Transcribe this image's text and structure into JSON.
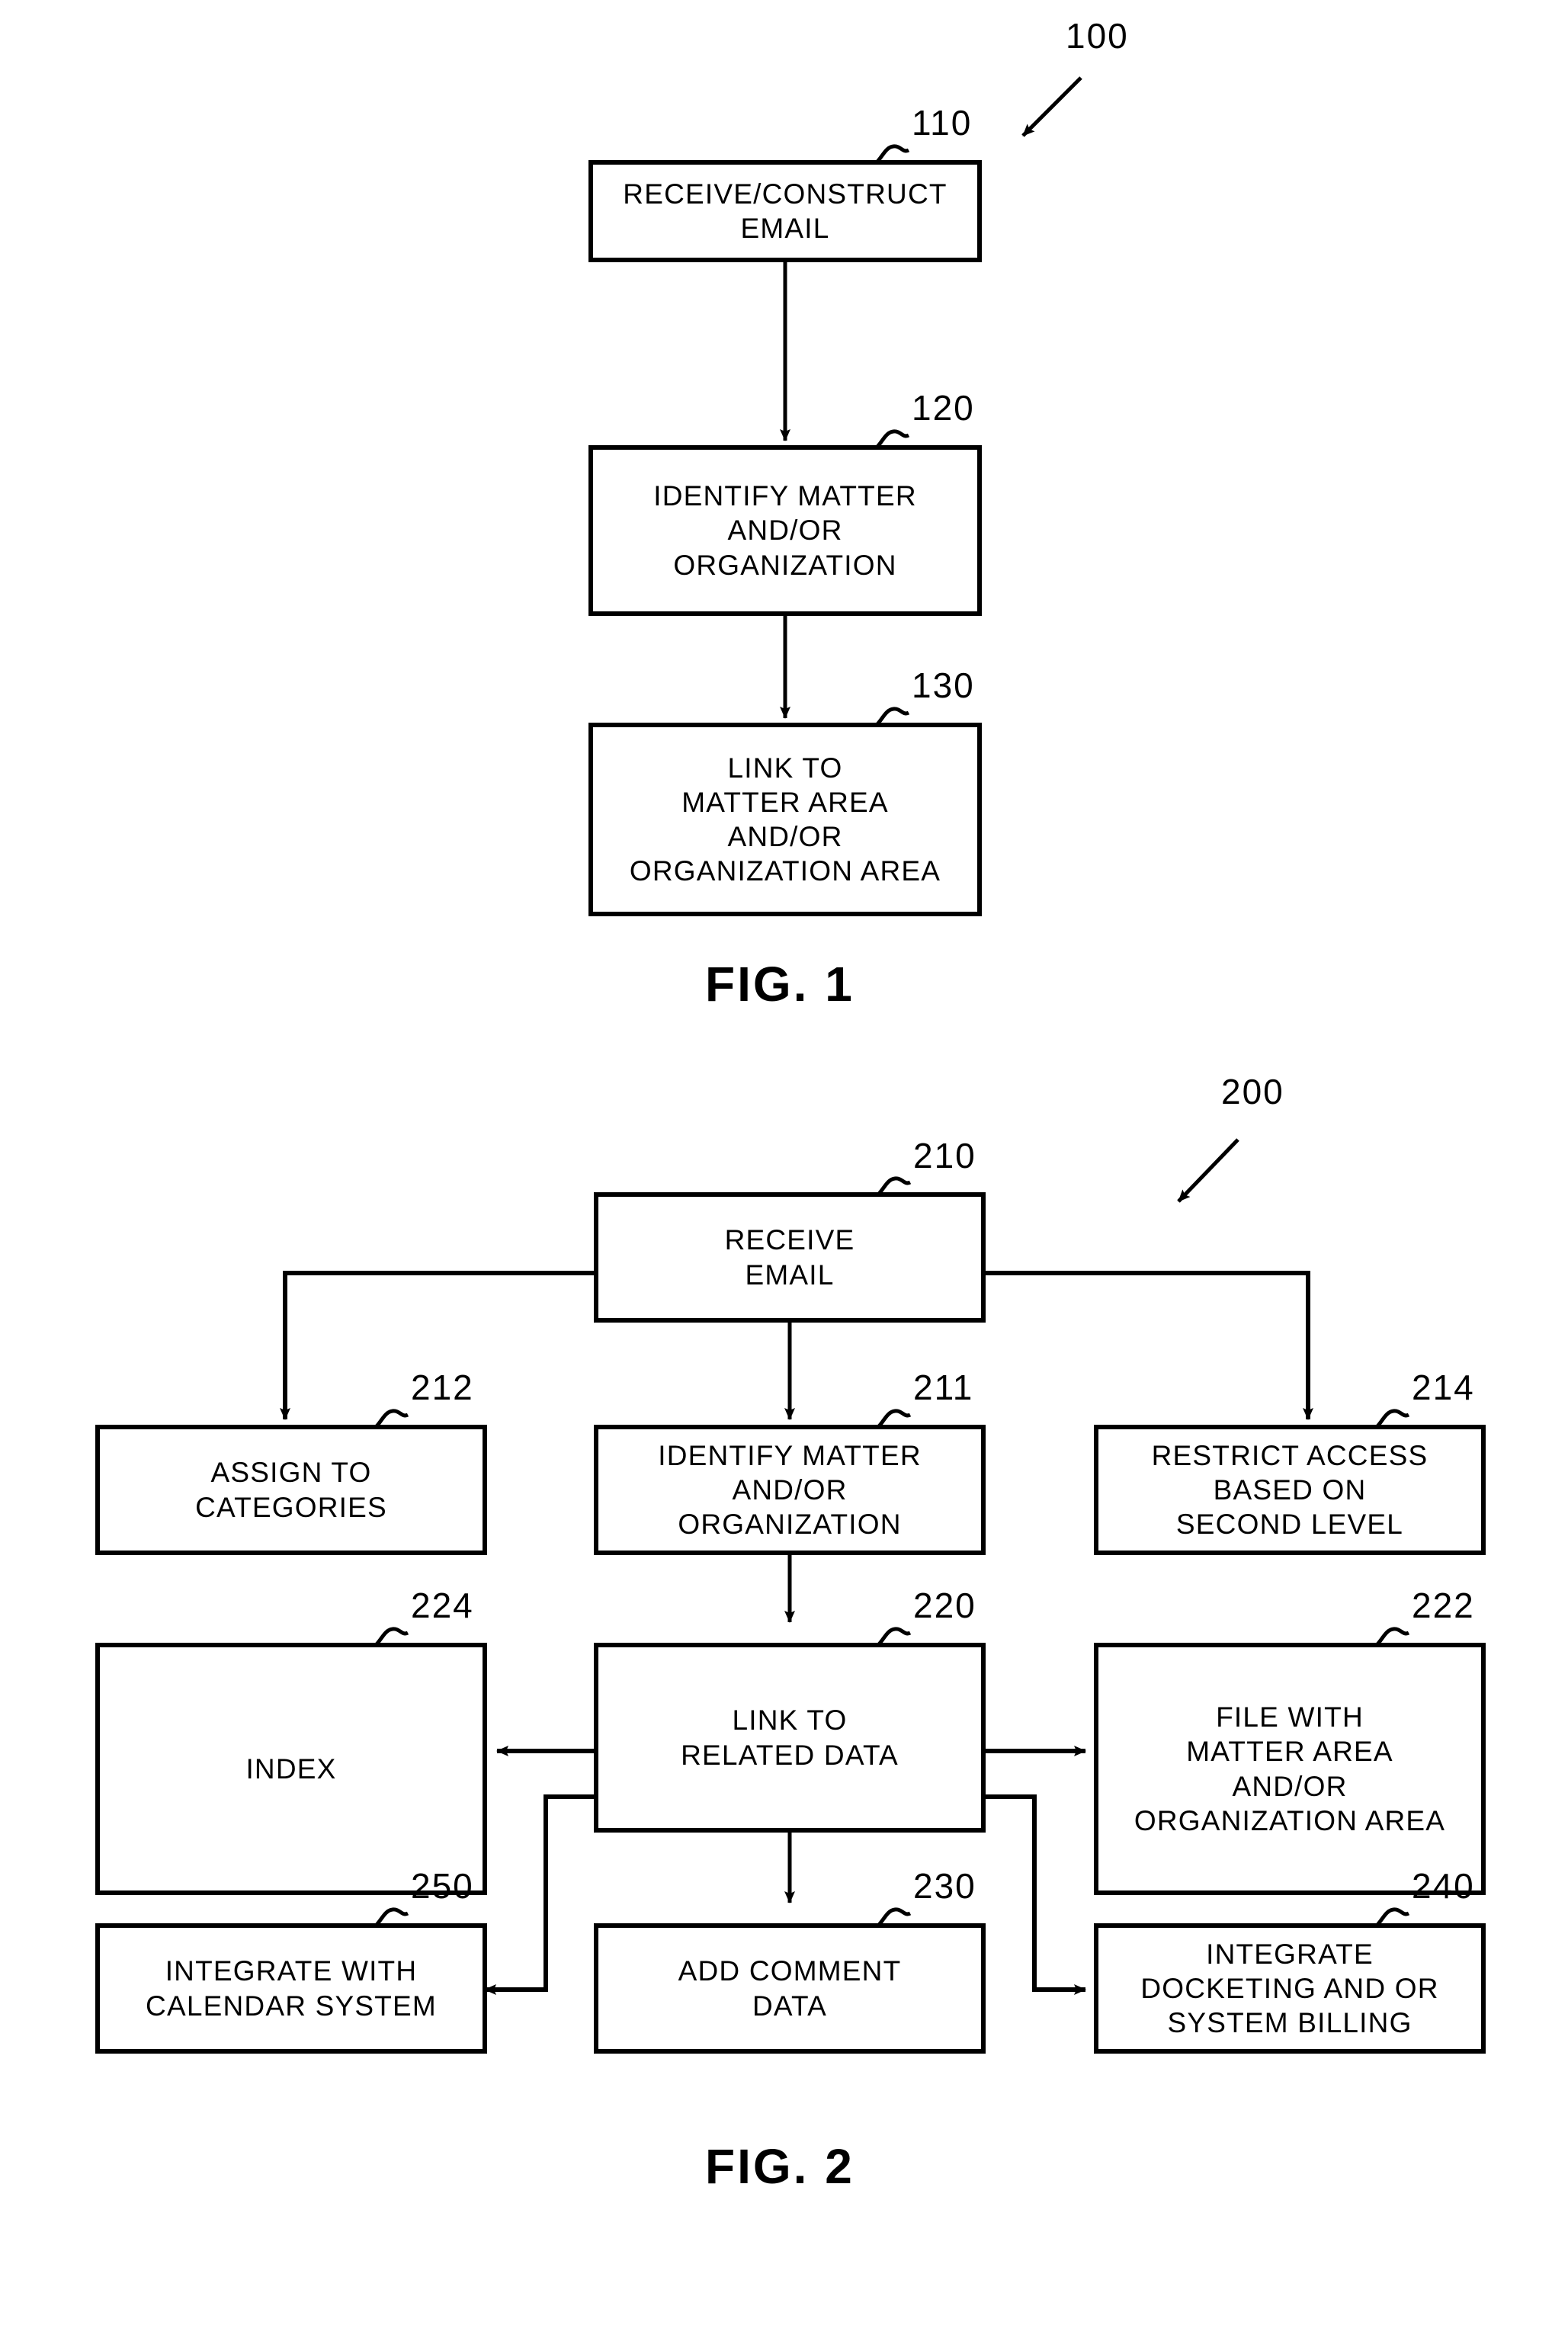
{
  "document": {
    "type": "patent-flowchart-sheet",
    "background_color": "#ffffff",
    "line_color": "#000000"
  },
  "figures": [
    {
      "id": "fig1",
      "caption": "FIG.  1",
      "reference_numeral": "100",
      "boxes": [
        {
          "ref": "110",
          "lines": [
            "RECEIVE/CONSTRUCT",
            "EMAIL"
          ]
        },
        {
          "ref": "120",
          "lines": [
            "IDENTIFY  MATTER",
            "AND/OR",
            "ORGANIZATION"
          ]
        },
        {
          "ref": "130",
          "lines": [
            "LINK  TO",
            "MATTER  AREA",
            "AND/OR",
            "ORGANIZATION  AREA"
          ]
        }
      ]
    },
    {
      "id": "fig2",
      "caption": "FIG.  2",
      "reference_numeral": "200",
      "boxes": [
        {
          "ref": "210",
          "lines": [
            "RECEIVE",
            "EMAIL"
          ]
        },
        {
          "ref": "212",
          "lines": [
            "ASSIGN  TO",
            "CATEGORIES"
          ]
        },
        {
          "ref": "211",
          "lines": [
            "IDENTIFY  MATTER",
            "AND/OR",
            "ORGANIZATION"
          ]
        },
        {
          "ref": "214",
          "lines": [
            "RESTRICT  ACCESS",
            "BASED  ON",
            "SECOND  LEVEL"
          ]
        },
        {
          "ref": "224",
          "lines": [
            "INDEX"
          ]
        },
        {
          "ref": "220",
          "lines": [
            "LINK  TO",
            "RELATED  DATA"
          ]
        },
        {
          "ref": "222",
          "lines": [
            "FILE  WITH",
            "MATTER  AREA",
            "AND/OR",
            "ORGANIZATION  AREA"
          ]
        },
        {
          "ref": "250",
          "lines": [
            "INTEGRATE  WITH",
            "CALENDAR  SYSTEM"
          ]
        },
        {
          "ref": "230",
          "lines": [
            "ADD  COMMENT",
            "DATA"
          ]
        },
        {
          "ref": "240",
          "lines": [
            "INTEGRATE",
            "DOCKETING  AND  OR",
            "SYSTEM  BILLING"
          ]
        }
      ]
    }
  ]
}
